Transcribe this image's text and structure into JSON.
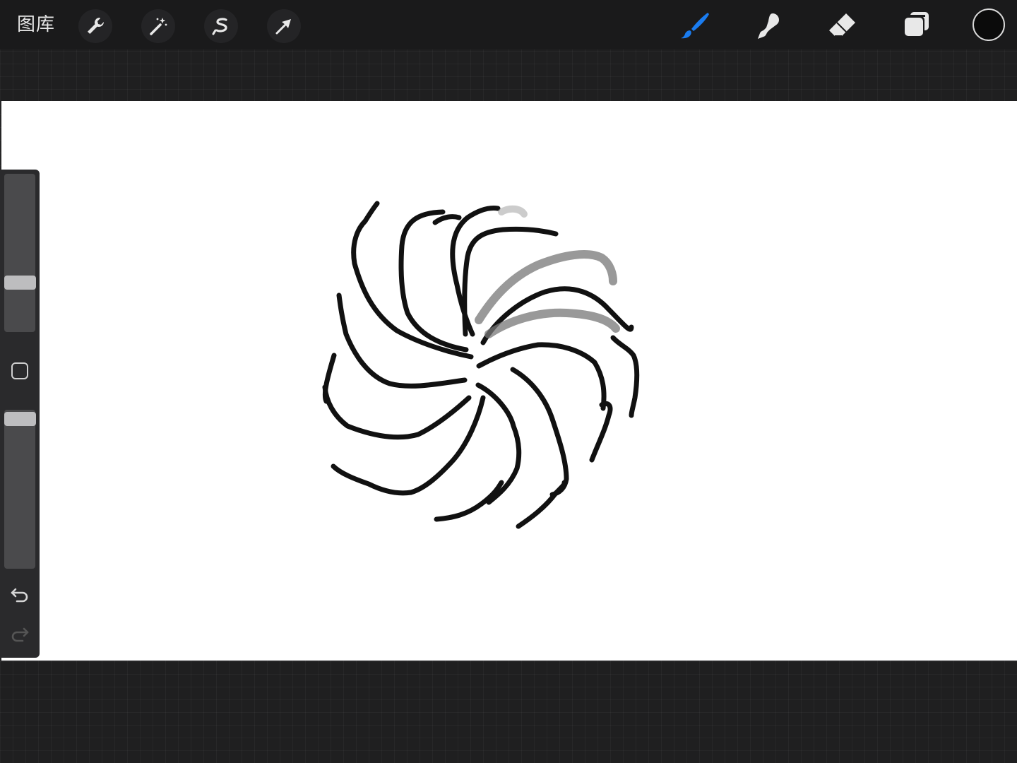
{
  "toolbar": {
    "gallery_label": "图库",
    "left_tools": [
      "wrench-icon",
      "magic-wand-icon",
      "selection-icon",
      "transform-arrow-icon"
    ],
    "right_tools": [
      "brush-icon",
      "smudge-icon",
      "eraser-icon",
      "layers-icon"
    ],
    "active_tool": "brush-icon",
    "accent_color": "#1a7cf0",
    "current_color": "#0b0b0b"
  },
  "sidebar": {
    "size_slider_level": 0.62,
    "opacity_slider_level": 0.95,
    "icons": [
      "modify-square-icon",
      "undo-icon",
      "redo-icon"
    ],
    "redo_enabled": false
  },
  "canvas": {
    "background": "#ffffff",
    "stroke_color": "#111111",
    "sketch": "swirl"
  }
}
